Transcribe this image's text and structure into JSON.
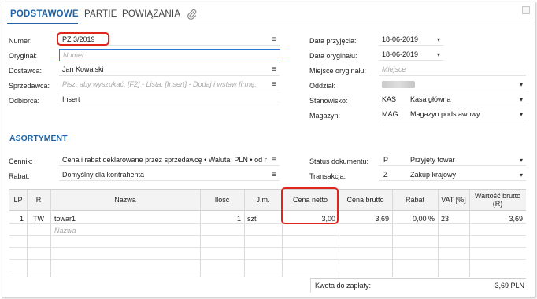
{
  "tabs": [
    {
      "label": "PODSTAWOWE",
      "active": true
    },
    {
      "label": "PARTIE",
      "active": false
    },
    {
      "label": "POWIĄZANIA",
      "active": false
    }
  ],
  "left_form": {
    "numer": {
      "label": "Numer:",
      "value": "PZ 3/2019"
    },
    "oryginal": {
      "label": "Oryginał:",
      "placeholder": "Numer"
    },
    "dostawca": {
      "label": "Dostawca:",
      "value": "Jan Kowalski"
    },
    "sprzedawca": {
      "label": "Sprzedawca:",
      "placeholder": "Pisz, aby wyszukać; [F2] - Lista; [Insert] - Dodaj i wstaw firmę;"
    },
    "odbiorca": {
      "label": "Odbiorca:",
      "value": "Insert"
    }
  },
  "right_form": {
    "data_przyjecia": {
      "label": "Data przyjęcia:",
      "value": "18-06-2019"
    },
    "data_oryginalu": {
      "label": "Data oryginału:",
      "value": "18-06-2019"
    },
    "miejsce_oryginalu": {
      "label": "Miejsce oryginału:",
      "placeholder": "Miejsce"
    },
    "oddzial": {
      "label": "Oddział:"
    },
    "stanowisko": {
      "label": "Stanowisko:",
      "code": "KAS",
      "name": "Kasa główna"
    },
    "magazyn": {
      "label": "Magazyn:",
      "code": "MAG",
      "name": "Magazyn podstawowy"
    }
  },
  "section_title": "ASORTYMENT",
  "assort_form": {
    "cennik": {
      "label": "Cennik:",
      "value": "Cena i rabat deklarowane przez sprzedawcę • Waluta: PLN • od net"
    },
    "rabat": {
      "label": "Rabat:",
      "value": "Domyślny dla kontrahenta"
    },
    "status": {
      "label": "Status dokumentu:",
      "code": "P",
      "name": "Przyjęty towar"
    },
    "transakcja": {
      "label": "Transakcja:",
      "code": "Z",
      "name": "Zakup krajowy"
    }
  },
  "table": {
    "headers": {
      "lp": "LP",
      "r": "R",
      "nazwa": "Nazwa",
      "ilosc": "Ilość",
      "jm": "J.m.",
      "cena_netto": "Cena netto",
      "cena_brutto": "Cena brutto",
      "rabat": "Rabat",
      "vat": "VAT [%]",
      "wartosc_brutto": "Wartość brutto (R)"
    },
    "row1": {
      "lp": "1",
      "r": "TW",
      "nazwa": "towar1",
      "ilosc": "1",
      "jm": "szt",
      "cena_netto": "3,00",
      "cena_brutto": "3,69",
      "rabat": "0,00 %",
      "vat": "23",
      "wartosc_brutto": "3,69"
    },
    "new_row_placeholder": "Nazwa"
  },
  "footer": {
    "label": "Kwota do zapłaty:",
    "value": "3,69 PLN"
  },
  "colors": {
    "accent": "#1f63a6",
    "highlight": "#e0251c",
    "focus": "#2d7ad6"
  }
}
